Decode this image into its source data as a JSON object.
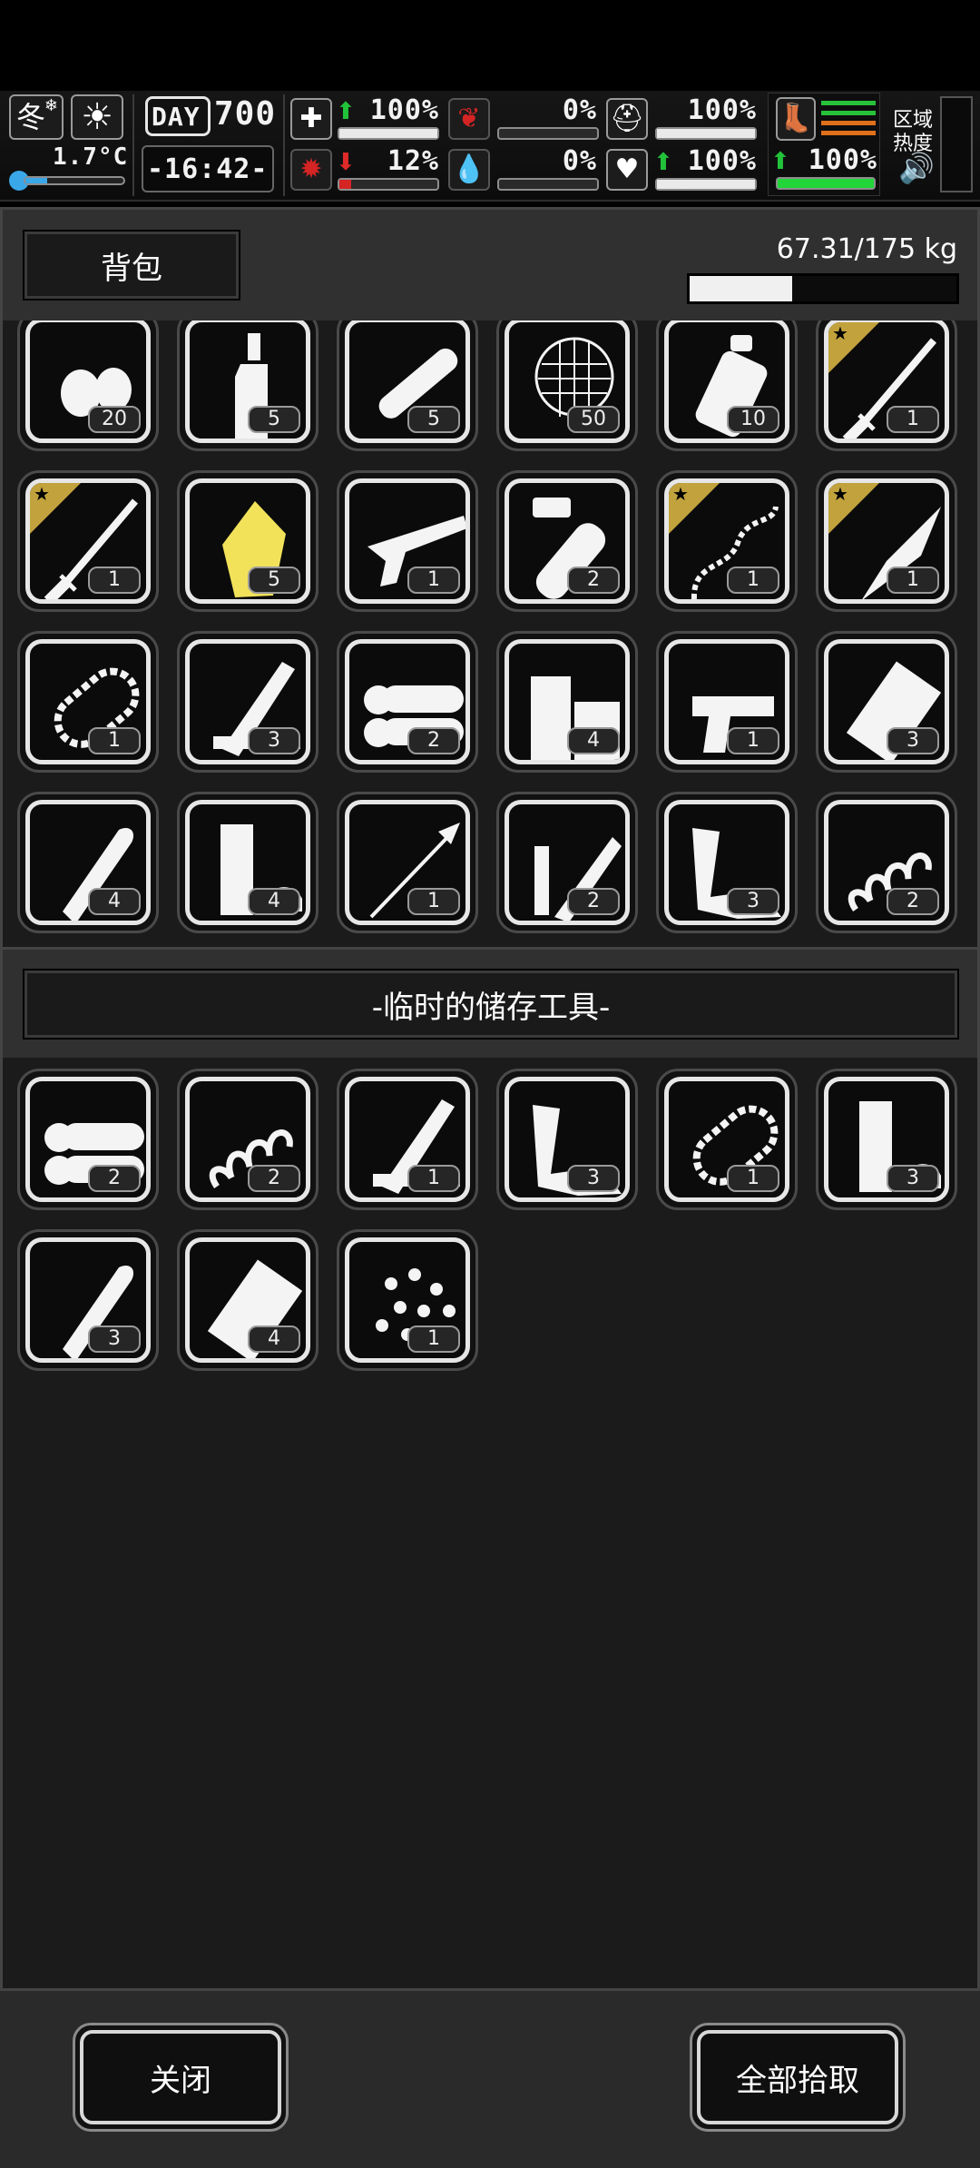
{
  "hud": {
    "season": "冬",
    "temperature": "1.7°C",
    "day_label": "DAY",
    "day_number": "700",
    "clock": "-16:42-",
    "health_pct": "100%",
    "stomach_pct": "0%",
    "armor_pct": "100%",
    "infection_pct": "12%",
    "thirst_pct": "0%",
    "mood_pct": "100%",
    "stamina_pct": "100%",
    "zone_heat_label_1": "区域",
    "zone_heat_label_2": "热度",
    "bars": {
      "health": 1.0,
      "stomach": 0.0,
      "armor": 1.0,
      "infection": 0.12,
      "thirst": 0.0,
      "mood": 1.0,
      "stamina": 1.0
    },
    "colors": {
      "up_arrow": "#22c33a",
      "down_arrow": "#e02a2a",
      "danger_icon": "#d42424",
      "stamina": "#22d63a",
      "orange": "#e0701a",
      "green": "#27c23a"
    }
  },
  "backpack": {
    "title": "背包",
    "weight_text": "67.31/175 kg",
    "weight_fraction": 0.385,
    "items": [
      {
        "icon": "eggs-icon",
        "count": "20",
        "star": false
      },
      {
        "icon": "bottle-icon",
        "count": "5",
        "star": false
      },
      {
        "icon": "pipe-icon",
        "count": "5",
        "star": false
      },
      {
        "icon": "net-icon",
        "count": "50",
        "star": false
      },
      {
        "icon": "water-bag-icon",
        "count": "10",
        "star": false
      },
      {
        "icon": "katana-icon",
        "count": "1",
        "star": true
      },
      {
        "icon": "katana-icon",
        "count": "1",
        "star": true
      },
      {
        "icon": "crystal-icon",
        "count": "5",
        "star": false
      },
      {
        "icon": "shotgun-icon",
        "count": "1",
        "star": false
      },
      {
        "icon": "test-tube-icon",
        "count": "2",
        "star": false
      },
      {
        "icon": "chain-whip-icon",
        "count": "1",
        "star": true
      },
      {
        "icon": "combat-knife-icon",
        "count": "1",
        "star": true
      },
      {
        "icon": "chainsaw-chain-icon",
        "count": "1",
        "star": false
      },
      {
        "icon": "planks-icon",
        "count": "3",
        "star": false
      },
      {
        "icon": "logs-icon",
        "count": "2",
        "star": false
      },
      {
        "icon": "wood-blocks-icon",
        "count": "4",
        "star": false
      },
      {
        "icon": "pistol-parts-icon",
        "count": "1",
        "star": false
      },
      {
        "icon": "metal-sheet-icon",
        "count": "3",
        "star": false
      },
      {
        "icon": "bullet-icon",
        "count": "4",
        "star": false
      },
      {
        "icon": "battery-clip-icon",
        "count": "4",
        "star": false
      },
      {
        "icon": "arrow-icon",
        "count": "1",
        "star": false
      },
      {
        "icon": "spear-part-icon",
        "count": "2",
        "star": false
      },
      {
        "icon": "scrap-metal-icon",
        "count": "3",
        "star": false
      },
      {
        "icon": "spring-icon",
        "count": "2",
        "star": false
      }
    ]
  },
  "storage": {
    "title": "-临时的储存工具-",
    "items": [
      {
        "icon": "logs-icon",
        "count": "2",
        "star": false
      },
      {
        "icon": "spring-icon",
        "count": "2",
        "star": false
      },
      {
        "icon": "planks-icon",
        "count": "1",
        "star": false
      },
      {
        "icon": "scrap-metal-icon",
        "count": "3",
        "star": false
      },
      {
        "icon": "chainsaw-chain-icon",
        "count": "1",
        "star": false
      },
      {
        "icon": "battery-clip-icon",
        "count": "3",
        "star": false
      },
      {
        "icon": "bullet-icon",
        "count": "3",
        "star": false
      },
      {
        "icon": "metal-sheet-icon",
        "count": "4",
        "star": false
      },
      {
        "icon": "pellets-icon",
        "count": "1",
        "star": false
      }
    ]
  },
  "buttons": {
    "close": "关闭",
    "take_all": "全部拾取"
  }
}
